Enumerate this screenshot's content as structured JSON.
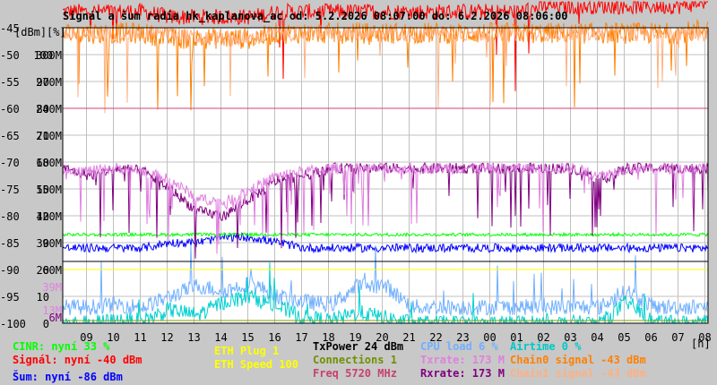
{
  "chart_data": {
    "type": "line",
    "title": "Signál a šum radia hk_kaplanova_ac od: 5.2.2026 08:07:00 do: 6.2.2026 08:06:00",
    "ylabel_dbm": "[dBm]",
    "ylabel_pct": "[%]",
    "xlabel": "[h]",
    "ylim": [
      -100,
      -45
    ],
    "yticks": [
      {
        "dbm": "-45",
        "pct": "",
        "rate": ""
      },
      {
        "dbm": "-50",
        "pct": "100",
        "rate": "300M"
      },
      {
        "dbm": "-55",
        "pct": "90",
        "rate": "270M"
      },
      {
        "dbm": "-60",
        "pct": "80",
        "rate": "240M"
      },
      {
        "dbm": "-65",
        "pct": "70",
        "rate": "210M"
      },
      {
        "dbm": "-70",
        "pct": "60",
        "rate": "180M"
      },
      {
        "dbm": "-75",
        "pct": "50",
        "rate": "150M"
      },
      {
        "dbm": "-80",
        "pct": "40",
        "rate": "120M"
      },
      {
        "dbm": "-85",
        "pct": "30",
        "rate": "90M"
      },
      {
        "dbm": "-90",
        "pct": "20",
        "rate": "60M"
      },
      {
        "dbm": "-95",
        "pct": "10",
        "rate": ""
      },
      {
        "dbm": "-100",
        "pct": "0",
        "rate": ""
      }
    ],
    "extra_ticks": [
      {
        "label": "39M",
        "color": "#e080e0"
      },
      {
        "label": "13M",
        "color": "#e080e0"
      },
      {
        "label": "6M",
        "color": "#800080"
      }
    ],
    "x": [
      "08",
      "09",
      "10",
      "11",
      "12",
      "13",
      "14",
      "15",
      "16",
      "17",
      "18",
      "19",
      "20",
      "21",
      "22",
      "23",
      "00",
      "01",
      "02",
      "03",
      "04",
      "05",
      "06",
      "07",
      "08"
    ],
    "xticks": [
      "09",
      "10",
      "11",
      "12",
      "13",
      "14",
      "15",
      "16",
      "17",
      "18",
      "19",
      "20",
      "21",
      "22",
      "23",
      "00",
      "01",
      "02",
      "03",
      "04",
      "05",
      "06",
      "07",
      "08"
    ],
    "grid": true,
    "series": [
      {
        "name": "Signál",
        "unit": "dBm",
        "color": "#ff0000",
        "values": [
          -42,
          -42,
          -42,
          -42,
          -43,
          -43,
          -43,
          -43,
          -42,
          -42,
          -42,
          -42,
          -42,
          -42,
          -42,
          -42,
          -42,
          -42,
          -41,
          -41,
          -41,
          -41,
          -41,
          -41,
          -40
        ]
      },
      {
        "name": "Chain0 signal",
        "unit": "dBm",
        "color": "#ff8000",
        "values": [
          -46,
          -46,
          -46,
          -46,
          -47,
          -47,
          -47,
          -47,
          -46,
          -46,
          -46,
          -46,
          -46,
          -46,
          -46,
          -46,
          -46,
          -46,
          -46,
          -46,
          -46,
          -46,
          -46,
          -46,
          -45
        ]
      },
      {
        "name": "Chain1 signal",
        "unit": "dBm",
        "color": "#ffb080",
        "values": [
          -46,
          -46,
          -46,
          -46,
          -46,
          -47,
          -47,
          -47,
          -46,
          -46,
          -46,
          -46,
          -46,
          -46,
          -46,
          -46,
          -46,
          -46,
          -46,
          -46,
          -46,
          -46,
          -46,
          -46,
          -46
        ]
      },
      {
        "name": "Šum",
        "unit": "dBm",
        "color": "#0000ff",
        "values": [
          -86,
          -86,
          -86,
          -86,
          -85,
          -85,
          -84,
          -84,
          -85,
          -86,
          -86,
          -86,
          -86,
          -86,
          -86,
          -86,
          -86,
          -86,
          -86,
          -86,
          -86,
          -86,
          -86,
          -86,
          -86
        ]
      },
      {
        "name": "CINR",
        "unit": "%",
        "color": "#00ff00",
        "values": [
          33,
          33,
          33,
          33,
          33,
          33,
          33,
          33,
          33,
          33,
          33,
          33,
          33,
          33,
          33,
          33,
          33,
          33,
          33,
          33,
          33,
          33,
          33,
          33,
          33
        ]
      },
      {
        "name": "Rxrate",
        "unit": "M",
        "color": "#800080",
        "values": [
          173,
          165,
          173,
          170,
          150,
          125,
          120,
          140,
          160,
          165,
          173,
          173,
          173,
          173,
          173,
          173,
          173,
          173,
          173,
          173,
          160,
          173,
          173,
          173,
          173
        ]
      },
      {
        "name": "Txrate",
        "unit": "M",
        "color": "#e080e0",
        "values": [
          173,
          170,
          173,
          170,
          160,
          140,
          135,
          150,
          165,
          170,
          173,
          173,
          173,
          173,
          173,
          173,
          173,
          173,
          173,
          173,
          165,
          173,
          173,
          173,
          173
        ]
      },
      {
        "name": "CPU load",
        "unit": "%",
        "color": "#70b0ff",
        "values": [
          6,
          6,
          7,
          6,
          10,
          14,
          12,
          15,
          10,
          8,
          7,
          14,
          14,
          6,
          6,
          6,
          6,
          6,
          6,
          6,
          6,
          12,
          6,
          6,
          6
        ]
      },
      {
        "name": "Airtime",
        "unit": "%",
        "color": "#00d0d0",
        "values": [
          0,
          0,
          1,
          1,
          5,
          3,
          8,
          10,
          6,
          2,
          1,
          4,
          2,
          0,
          0,
          0,
          0,
          0,
          0,
          0,
          0,
          8,
          0,
          0,
          0
        ]
      },
      {
        "name": "Freq",
        "unit": "MHz",
        "color": "#d04070",
        "level": -60
      },
      {
        "name": "TxPower",
        "unit": "dBm",
        "color": "#000000",
        "level": -88.5
      },
      {
        "name": "ETH Speed",
        "unit": "",
        "color": "#ffff00",
        "level": -90
      },
      {
        "name": "Connections",
        "unit": "",
        "color": "#80a000",
        "level": -99.5
      }
    ]
  },
  "legend": {
    "cinr": "CINR: nyní 33 %",
    "signal": "Signál: nyní -40 dBm",
    "noise": "Šum: nyní -86 dBm",
    "eth_plug": "ETH Plug 1",
    "eth_speed": "ETH Speed 100",
    "txpower": "TxPower 24 dBm",
    "connections": "Connections 1",
    "freq": "Freq 5720 MHz",
    "cpu": "CPU load 6 %",
    "txrate": "Txrate: 173 M",
    "rxrate": "Rxrate: 173 M",
    "airtime": "Airtime 0 %",
    "chain0": "Chain0 signal -43 dBm",
    "chain1": "Chain1 signal -43 dBm"
  }
}
